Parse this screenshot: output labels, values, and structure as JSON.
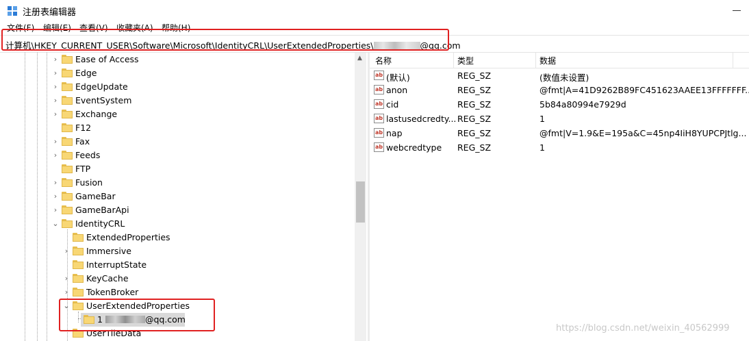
{
  "window": {
    "title": "注册表编辑器"
  },
  "menu": [
    "文件(F)",
    "编辑(E)",
    "查看(V)",
    "收藏夹(A)",
    "帮助(H)"
  ],
  "address": {
    "prefix": "计算机\\HKEY_CURRENT_USER\\Software\\Microsoft\\IdentityCRL\\UserExtendedProperties\\",
    "suffix": "@qq.com"
  },
  "tree": [
    {
      "label": "Ease of Access",
      "expand": "›"
    },
    {
      "label": "Edge",
      "expand": "›"
    },
    {
      "label": "EdgeUpdate",
      "expand": "›"
    },
    {
      "label": "EventSystem",
      "expand": "›"
    },
    {
      "label": "Exchange",
      "expand": "›"
    },
    {
      "label": "F12",
      "expand": ""
    },
    {
      "label": "Fax",
      "expand": "›"
    },
    {
      "label": "Feeds",
      "expand": "›"
    },
    {
      "label": "FTP",
      "expand": ""
    },
    {
      "label": "Fusion",
      "expand": "›"
    },
    {
      "label": "GameBar",
      "expand": "›"
    },
    {
      "label": "GameBarApi",
      "expand": "›"
    },
    {
      "label": "IdentityCRL",
      "expand": "⌄"
    },
    {
      "label": "ExtendedProperties",
      "expand": ""
    },
    {
      "label": "Immersive",
      "expand": "›"
    },
    {
      "label": "InterruptState",
      "expand": ""
    },
    {
      "label": "KeyCache",
      "expand": "›"
    },
    {
      "label": "TokenBroker",
      "expand": "›"
    },
    {
      "label": "UserExtendedProperties",
      "expand": "⌄"
    },
    {
      "label_prefix": "1",
      "label_suffix": "@qq.com",
      "expand": ""
    },
    {
      "label": "UserTileData",
      "expand": ""
    }
  ],
  "list": {
    "headers": {
      "name": "名称",
      "type": "类型",
      "data": "数据"
    },
    "rows": [
      {
        "name": "(默认)",
        "type": "REG_SZ",
        "data": "(数值未设置)"
      },
      {
        "name": "anon",
        "type": "REG_SZ",
        "data": "@fmt|A=41D9262B89FC451623AAEE13FFFFFFF..."
      },
      {
        "name": "cid",
        "type": "REG_SZ",
        "data": "5b84a80994e7929d"
      },
      {
        "name": "lastusedcredty...",
        "type": "REG_SZ",
        "data": "1"
      },
      {
        "name": "nap",
        "type": "REG_SZ",
        "data": "@fmt|V=1.9&E=195a&C=45np4IiH8YUPCPJtlg..."
      },
      {
        "name": "webcredtype",
        "type": "REG_SZ",
        "data": "1"
      }
    ]
  },
  "watermark": "https://blog.csdn.net/weixin_40562999",
  "colors": {
    "highlight": "#e02020",
    "folder": "#f8d775",
    "selection": "#d9d9d9"
  }
}
